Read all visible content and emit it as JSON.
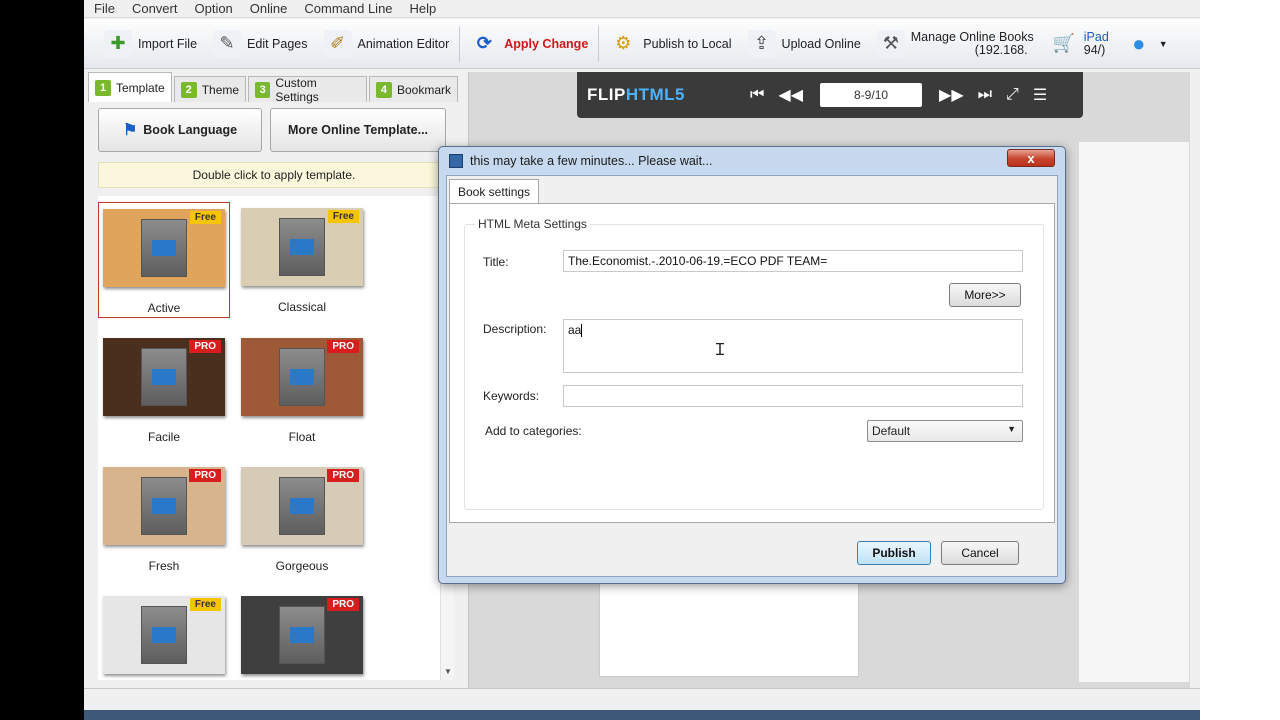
{
  "menu": [
    "File",
    "Convert",
    "Option",
    "Online",
    "Command Line",
    "Help"
  ],
  "toolbar": {
    "import_file": "Import File",
    "edit_pages": "Edit Pages",
    "animation_editor": "Animation Editor",
    "apply_change": "Apply Change",
    "publish_local": "Publish to Local",
    "upload_online": "Upload Online",
    "manage_online": "Manage Online Books",
    "manage_sub": "(192.168.",
    "ipad": "iPad",
    "ipad_sub": "94/)"
  },
  "left_panel": {
    "tabs": [
      {
        "num": "1",
        "label": "Template"
      },
      {
        "num": "2",
        "label": "Theme"
      },
      {
        "num": "3",
        "label": "Custom Settings"
      },
      {
        "num": "4",
        "label": "Bookmark"
      }
    ],
    "book_language": "Book Language",
    "more_templates": "More Online Template...",
    "hint": "Double click to apply template.",
    "templates": [
      {
        "name": "Active",
        "badge": "Free",
        "bg": "#e0a55a"
      },
      {
        "name": "Classical",
        "badge": "Free",
        "bg": "#d9cdb4"
      },
      {
        "name": "Facile",
        "badge": "PRO",
        "bg": "#4a2f1e"
      },
      {
        "name": "Float",
        "badge": "PRO",
        "bg": "#9e5a37"
      },
      {
        "name": "Fresh",
        "badge": "PRO",
        "bg": "#d8b48c"
      },
      {
        "name": "Gorgeous",
        "badge": "PRO",
        "bg": "#d6cbb6"
      },
      {
        "name": "",
        "badge": "Free",
        "bg": "#e6e6e6"
      },
      {
        "name": "",
        "badge": "PRO",
        "bg": "#3f3f3f"
      }
    ]
  },
  "preview": {
    "logo_a": "FLIP",
    "logo_b": "HTML5",
    "page_indicator": "8-9/10"
  },
  "dialog": {
    "title": "this may take a few minutes... Please wait...",
    "close": "x",
    "tab": "Book settings",
    "group": "HTML Meta Settings",
    "title_label": "Title:",
    "title_value": "The.Economist.-.2010-06-19.=ECO PDF TEAM=",
    "more_button": "More>>",
    "description_label": "Description:",
    "description_value": "aa",
    "keywords_label": "Keywords:",
    "keywords_value": "",
    "categories_label": "Add to categories:",
    "categories_value": "Default",
    "publish": "Publish",
    "cancel": "Cancel"
  }
}
